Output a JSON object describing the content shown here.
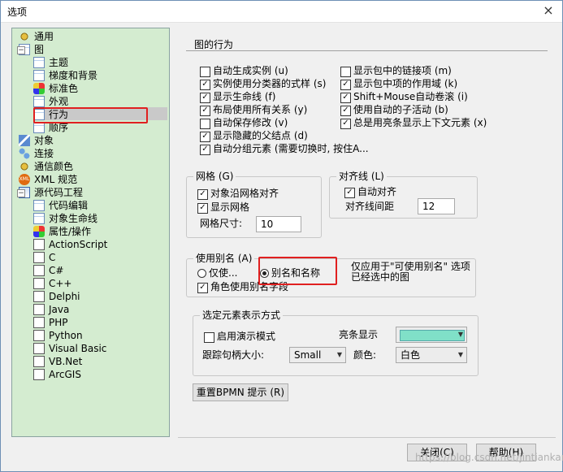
{
  "window": {
    "title": "选项",
    "close_glyph": "×"
  },
  "tree": {
    "items": [
      {
        "label": "通用",
        "icon": "gear-icon"
      },
      {
        "label": "图",
        "icon": "diagram-icon"
      },
      {
        "label": "主题",
        "icon": "doc-icon"
      },
      {
        "label": "梯度和背景",
        "icon": "doc-icon"
      },
      {
        "label": "标准色",
        "icon": "color-icon"
      },
      {
        "label": "外观",
        "icon": "doc-icon"
      },
      {
        "label": "行为",
        "icon": "doc-icon"
      },
      {
        "label": "顺序",
        "icon": "doc-icon"
      },
      {
        "label": "对象",
        "icon": "object-icon"
      },
      {
        "label": "连接",
        "icon": "link-icon"
      },
      {
        "label": "通信颜色",
        "icon": "gear-icon"
      },
      {
        "label": "XML 规范",
        "icon": "xml-icon"
      },
      {
        "label": "源代码工程",
        "icon": "project-icon"
      },
      {
        "label": "代码编辑",
        "icon": "doc-icon"
      },
      {
        "label": "对象生命线",
        "icon": "doc-icon"
      },
      {
        "label": "属性/操作",
        "icon": "color-icon"
      },
      {
        "label": "ActionScript",
        "icon": "lang-icon"
      },
      {
        "label": "C",
        "icon": "lang-icon"
      },
      {
        "label": "C#",
        "icon": "lang-icon"
      },
      {
        "label": "C++",
        "icon": "lang-icon"
      },
      {
        "label": "Delphi",
        "icon": "lang-icon"
      },
      {
        "label": "Java",
        "icon": "lang-icon"
      },
      {
        "label": "PHP",
        "icon": "lang-icon"
      },
      {
        "label": "Python",
        "icon": "lang-icon"
      },
      {
        "label": "Visual Basic",
        "icon": "lang-icon"
      },
      {
        "label": "VB.Net",
        "icon": "lang-icon"
      },
      {
        "label": "ArcGIS",
        "icon": "lang-icon"
      }
    ],
    "selected": "行为"
  },
  "behavior": {
    "title": "图的行为",
    "left_options": [
      {
        "label": "自动生成实例 (u)",
        "checked": false
      },
      {
        "label": "实例使用分类器的式样 (s)",
        "checked": true
      },
      {
        "label": "显示生命线 (f)",
        "checked": true
      },
      {
        "label": "布局使用所有关系 (y)",
        "checked": true
      },
      {
        "label": "自动保存修改 (v)",
        "checked": false
      },
      {
        "label": "显示隐藏的父结点 (d)",
        "checked": true
      },
      {
        "label": "自动分组元素 (需要切换时, 按住A...",
        "checked": true
      }
    ],
    "right_options": [
      {
        "label": "显示包中的链接项 (m)",
        "checked": false
      },
      {
        "label": "显示包中项的作用域 (k)",
        "checked": true
      },
      {
        "label": "Shift+Mouse自动卷滚 (i)",
        "checked": true
      },
      {
        "label": "使用自动的子活动 (b)",
        "checked": true
      },
      {
        "label": "总是用亮条显示上下文元素 (x)",
        "checked": true
      }
    ]
  },
  "grid": {
    "title": "网格 (G)",
    "snap_label": "对象沿网格对齐",
    "snap_checked": true,
    "show_label": "显示网格",
    "show_checked": true,
    "size_label": "网格尺寸:",
    "size_value": "10"
  },
  "align": {
    "title": "对齐线 (L)",
    "auto_label": "自动对齐",
    "auto_checked": true,
    "spacing_label": "对齐线间距",
    "spacing_value": "12"
  },
  "alias": {
    "title": "使用别名 (A)",
    "only_label": "仅使...",
    "both_label": "别名和名称",
    "selected": "both",
    "note_line1": "仅应用于\"可使用别名\" 选项",
    "note_line2": "已经选中的图",
    "role_label": "角色使用别名字段",
    "role_checked": true
  },
  "selection": {
    "title": "选定元素表示方式",
    "demo_label": "启用演示模式",
    "demo_checked": false,
    "highlight_label": "亮条显示",
    "highlight_color": "#80e0c8",
    "handle_label": "跟踪句柄大小:",
    "handle_value": "Small",
    "color_label": "颜色:",
    "color_value": "白色"
  },
  "buttons": {
    "reset_bpmn": "重置BPMN 提示 (R)",
    "close": "关闭(C)",
    "help": "帮助(H)"
  },
  "watermark": "https://blog.csdn.net/jintiankang"
}
